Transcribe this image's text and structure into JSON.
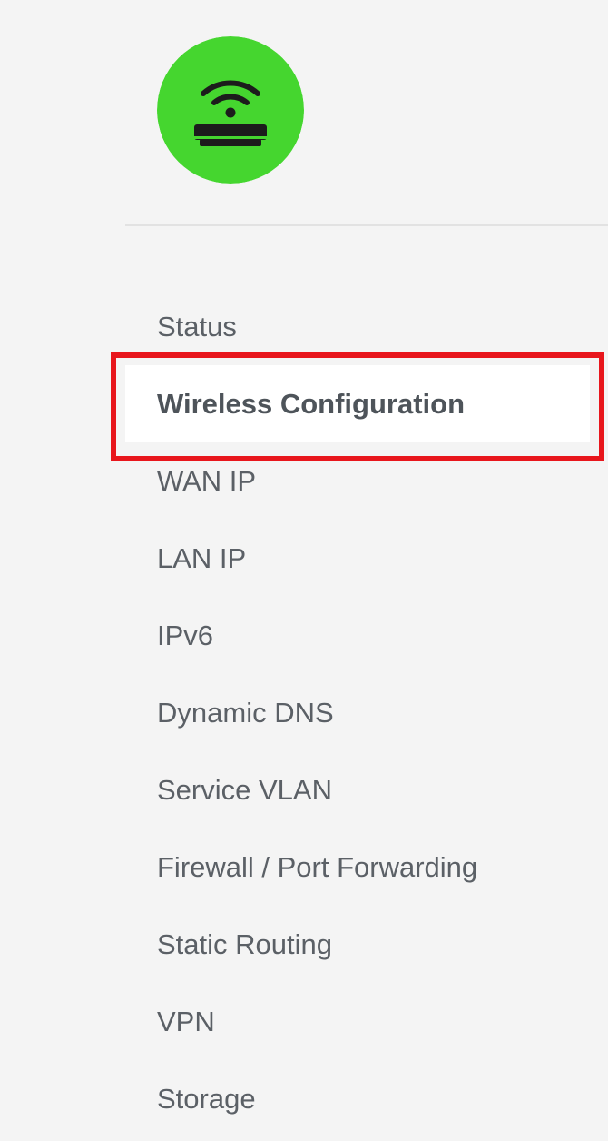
{
  "sidebar": {
    "logo": {
      "icon": "wifi-router-icon",
      "background_color": "#45d62f",
      "icon_color": "#1c1c1c"
    },
    "items": [
      {
        "label": "Status",
        "active": false
      },
      {
        "label": "Wireless Configuration",
        "active": true
      },
      {
        "label": "WAN IP",
        "active": false
      },
      {
        "label": "LAN IP",
        "active": false
      },
      {
        "label": "IPv6",
        "active": false
      },
      {
        "label": "Dynamic DNS",
        "active": false
      },
      {
        "label": "Service VLAN",
        "active": false
      },
      {
        "label": "Firewall / Port Forwarding",
        "active": false
      },
      {
        "label": "Static Routing",
        "active": false
      },
      {
        "label": "VPN",
        "active": false
      },
      {
        "label": "Storage",
        "active": false
      }
    ]
  },
  "annotation": {
    "highlight_color": "#e8161c"
  }
}
